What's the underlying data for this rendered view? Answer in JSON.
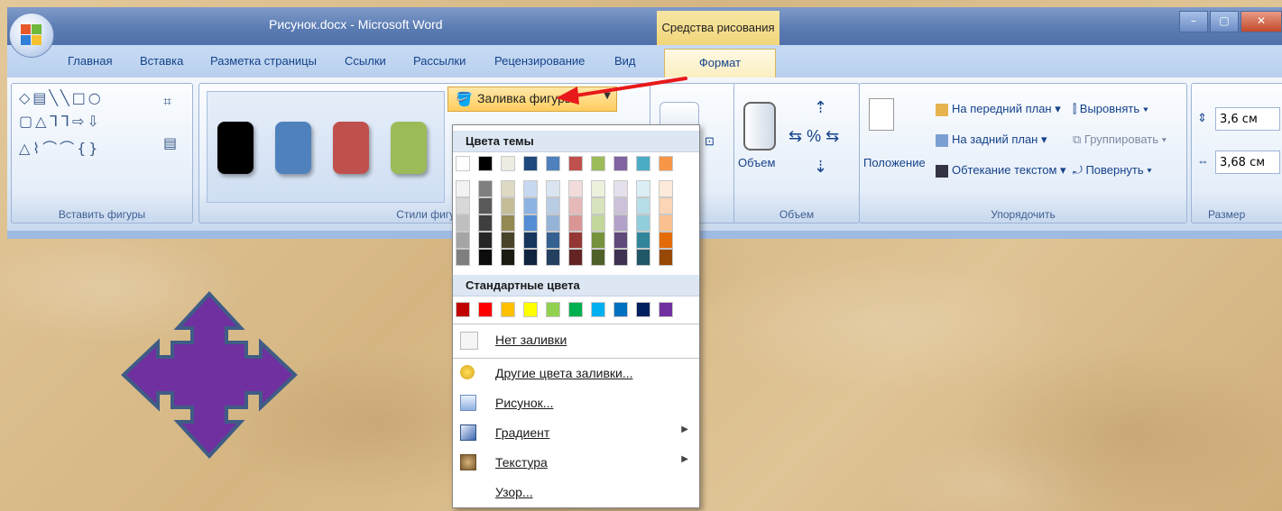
{
  "window": {
    "title": "Рисунок.docx - Microsoft Word",
    "context_tab_title": "Средства рисования"
  },
  "tabs": [
    "Главная",
    "Вставка",
    "Разметка страницы",
    "Ссылки",
    "Рассылки",
    "Рецензирование",
    "Вид"
  ],
  "active_tab": "Формат",
  "groups": {
    "insert_shapes": "Вставить фигуры",
    "shape_styles": "Стили фигур",
    "volume": "Объем",
    "arrange": "Упорядочить",
    "size": "Размер"
  },
  "shape_style_colors": [
    "#000000",
    "#4f81bd",
    "#c0504d",
    "#9bbb59"
  ],
  "fill_button": {
    "label": "Заливка фигуры"
  },
  "volume": {
    "label": "Объем"
  },
  "arrange": {
    "position": "Положение",
    "bring_front": "На передний план",
    "send_back": "На задний план",
    "wrap_text": "Обтекание текстом",
    "align": "Выровнять",
    "group": "Группировать",
    "rotate": "Повернуть"
  },
  "size": {
    "height": "3,6 см",
    "width": "3,68 см"
  },
  "menu": {
    "theme_colors_header": "Цвета темы",
    "theme_colors": [
      "#ffffff",
      "#000000",
      "#eeece1",
      "#1f497d",
      "#4f81bd",
      "#c0504d",
      "#9bbb59",
      "#8064a2",
      "#4bacc6",
      "#f79646"
    ],
    "theme_tints": [
      [
        "#f2f2f2",
        "#d8d8d8",
        "#bfbfbf",
        "#a5a5a5",
        "#7f7f7f"
      ],
      [
        "#7f7f7f",
        "#595959",
        "#3f3f3f",
        "#262626",
        "#0c0c0c"
      ],
      [
        "#ddd9c3",
        "#c4bd97",
        "#938953",
        "#494429",
        "#1d1b10"
      ],
      [
        "#c6d9f0",
        "#8db3e2",
        "#548dd4",
        "#17365d",
        "#0f243e"
      ],
      [
        "#dbe5f1",
        "#b8cce4",
        "#95b3d7",
        "#366092",
        "#244061"
      ],
      [
        "#f2dcdb",
        "#e5b9b7",
        "#d99694",
        "#953734",
        "#632423"
      ],
      [
        "#ebf1dd",
        "#d7e3bc",
        "#c3d69b",
        "#76923c",
        "#4f6128"
      ],
      [
        "#e5e0ec",
        "#ccc1d9",
        "#b2a2c7",
        "#5f497a",
        "#3f3151"
      ],
      [
        "#dbeef3",
        "#b7dde8",
        "#92cddc",
        "#31859b",
        "#205867"
      ],
      [
        "#fdeada",
        "#fbd5b5",
        "#fac08f",
        "#e36c09",
        "#974806"
      ]
    ],
    "standard_colors_header": "Стандартные цвета",
    "standard_colors": [
      "#c00000",
      "#ff0000",
      "#ffc000",
      "#ffff00",
      "#92d050",
      "#00b050",
      "#00b0f0",
      "#0070c0",
      "#002060",
      "#7030a0"
    ],
    "no_fill": "Нет заливки",
    "more_colors": "Другие цвета заливки...",
    "picture": "Рисунок...",
    "gradient": "Градиент",
    "texture": "Текстура",
    "pattern": "Узор..."
  },
  "shape_fill": "#7030a0"
}
